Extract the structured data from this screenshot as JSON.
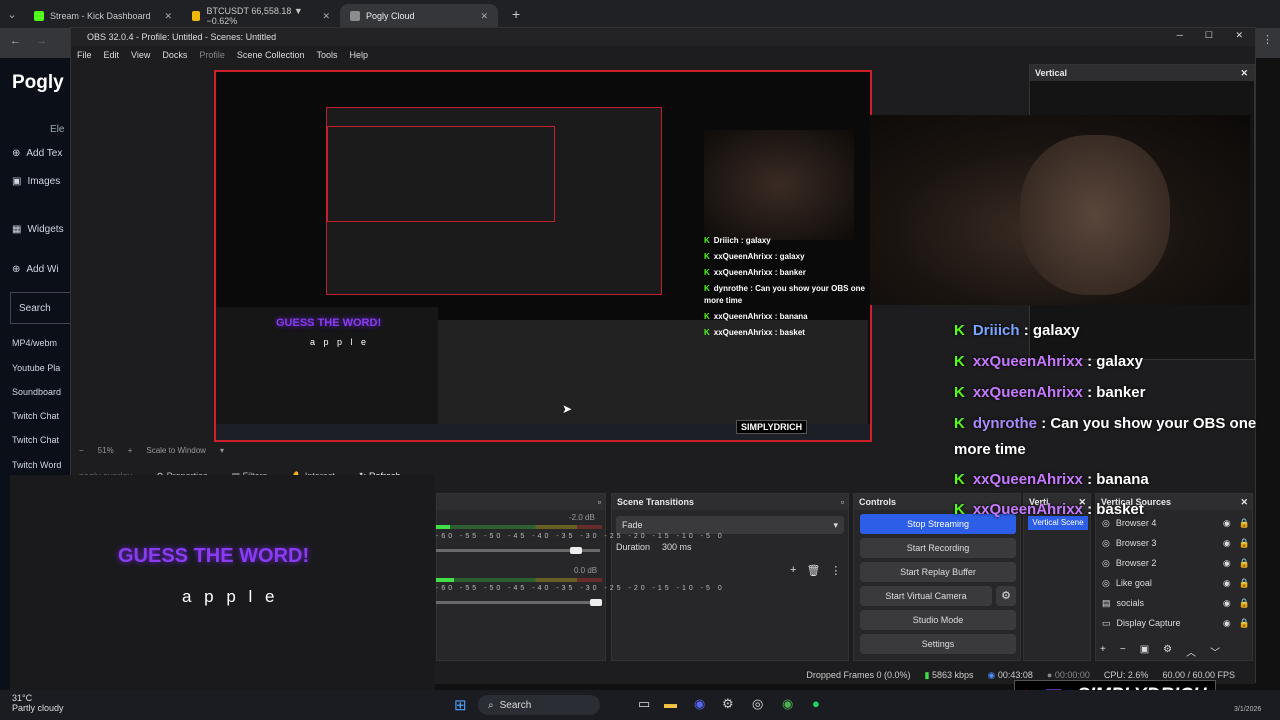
{
  "tabs": [
    {
      "label": "Stream - Kick Dashboard",
      "color": "#53fc18"
    },
    {
      "label": "BTCUSDT 66,558.18 ▼ −0.62%",
      "color": "#f0b90b"
    },
    {
      "label": "Pogly Cloud",
      "color": "#8c8c8c"
    }
  ],
  "pogly": {
    "title": "Pogly",
    "elements_label": "Ele",
    "add_text": "Add Tex",
    "images": "Images",
    "widgets": "Widgets",
    "add_widget": "Add Wi",
    "search_label": "Search",
    "list": [
      "MP4/webm",
      "Youtube Pla",
      "Soundboard",
      "Twitch Chat",
      "Twitch Chat",
      "Twitch Word"
    ]
  },
  "obs": {
    "title": "OBS 32.0.4 - Profile: Untitled - Scenes: Untitled",
    "menu": [
      "File",
      "Edit",
      "View",
      "Docks",
      "Profile",
      "Scene Collection",
      "Tools",
      "Help"
    ],
    "vertical_title": "Vertical",
    "zoom": "51%",
    "scale_mode": "Scale to Window",
    "overlay_name": "pogly overlay",
    "props": [
      "Properties",
      "Filters",
      "Interact",
      "Refresh"
    ]
  },
  "overlay": {
    "headline": "GUESS THE WORD!",
    "word": "a p p l e"
  },
  "chat": [
    {
      "name": "Driiich",
      "msg": ": galaxy"
    },
    {
      "name": "xxQueenAhrixx",
      "msg": ": galaxy"
    },
    {
      "name": "xxQueenAhrixx",
      "msg": ": banker"
    },
    {
      "name": "dynrothe",
      "msg": ": Can you show your OBS one"
    },
    {
      "name": "",
      "msg": "more time"
    },
    {
      "name": "xxQueenAhrixx",
      "msg": ": banana"
    },
    {
      "name": "xxQueenAhrixx",
      "msg": ": basket"
    }
  ],
  "small_chat": [
    {
      "name": "Driiich",
      "msg": ": galaxy"
    },
    {
      "name": "xxQueenAhrixx",
      "msg": ": galaxy"
    },
    {
      "name": "xxQueenAhrixx",
      "msg": ": banker"
    },
    {
      "name": "dynrothe",
      "msg": ": Can you show your OBS one"
    },
    {
      "name": "",
      "msg": "more time"
    },
    {
      "name": "xxQueenAhrixx",
      "msg": ": banana"
    },
    {
      "name": "xxQueenAhrixx",
      "msg": ": basket"
    }
  ],
  "mixer": {
    "ch1_db": "-2.0 dB",
    "ch2_db": "0.0 dB",
    "ticks": "-60 -55 -50 -45 -40 -35 -30 -25 -20 -15 -10 -5 0"
  },
  "transitions": {
    "title": "Scene Transitions",
    "selected": "Fade",
    "duration_label": "Duration",
    "duration_value": "300 ms"
  },
  "controls": {
    "title": "Controls",
    "buttons": [
      "Stop Streaming",
      "Start Recording",
      "Start Replay Buffer",
      "Start Virtual Camera",
      "Studio Mode",
      "Settings"
    ]
  },
  "vertical_scenes": {
    "title": "Verti",
    "selected": "Vertical Scene"
  },
  "vertical_sources": {
    "title": "Vertical Sources",
    "items": [
      "Browser 4",
      "Browser 3",
      "Browser 2",
      "Like goal",
      "socials",
      "Display Capture"
    ]
  },
  "status": {
    "dropped": "Dropped Frames 0 (0.0%)",
    "bitrate": "5863 kbps",
    "live_time": "00:43:08",
    "rec_time": "00:00:00",
    "cpu": "CPU: 2.6%",
    "fps": "60.00 / 60.00 FPS"
  },
  "branding": {
    "handle": "SIMPLYDRICH"
  },
  "taskbar": {
    "weather_temp": "31°C",
    "weather_desc": "Partly cloudy",
    "search": "Search",
    "date": "3/1/2026"
  }
}
